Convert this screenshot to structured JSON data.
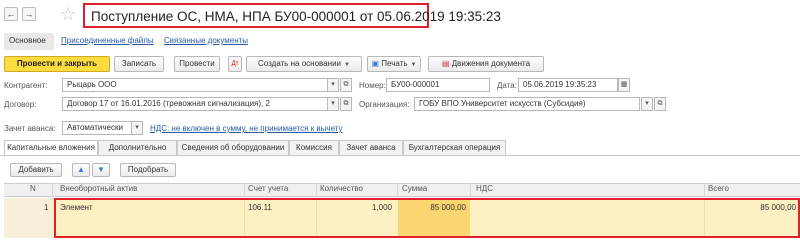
{
  "header": {
    "back_icon": "back-arrow-icon",
    "forward_icon": "forward-arrow-icon",
    "star_icon": "star-icon",
    "title": "Поступление ОС, НМА, НПА БУ00-000001 от 05.06.2019 19:35:23"
  },
  "nav": {
    "main": "Основное",
    "attached_files": "Присоединенные файлы",
    "related_docs": "Связанные документы"
  },
  "toolbar": {
    "post_close": "Провести и закрыть",
    "save": "Записать",
    "post": "Провести",
    "create_based": "Создать на основании",
    "print": "Печать",
    "movements": "Движения документа"
  },
  "form": {
    "counterparty_label": "Контрагент:",
    "counterparty_value": "Рыцарь ООО",
    "number_label": "Номер:",
    "number_value": "БУ00-000001",
    "date_label": "Дата:",
    "date_value": "05.06.2019 19:35:23",
    "contract_label": "Договор:",
    "contract_value": "Договор 17 от 16.01.2016 (тревожная сигнализация), 2",
    "org_label": "Организация:",
    "org_value": "ГОБУ ВПО Университет искусств (Субсидия)",
    "advance_label": "Зачет аванса:",
    "advance_value": "Автоматически",
    "vat_link": "НДС: не включен в сумму, не принимается к вычету"
  },
  "tabs": [
    "Капитальные вложения",
    "Дополнительно",
    "Сведения об оборудовании",
    "Комиссия",
    "Зачет аванса",
    "Бухгалтерская операция"
  ],
  "grid_toolbar": {
    "add": "Добавить",
    "pick": "Подобрать"
  },
  "table": {
    "columns": [
      "N",
      "Внеоборотный актив",
      "Счет учета",
      "Количество",
      "Сумма",
      "НДС",
      "Всего"
    ],
    "rows": [
      [
        "1",
        "Элемент",
        "106.11",
        "1,000",
        "85 000,00",
        "",
        "85 000,00"
      ]
    ]
  },
  "colors": {
    "primary_button": "#fcdc3e",
    "highlight_border": "#e0202a",
    "row_background": "#fdf0c2",
    "link": "#2a59a4"
  }
}
